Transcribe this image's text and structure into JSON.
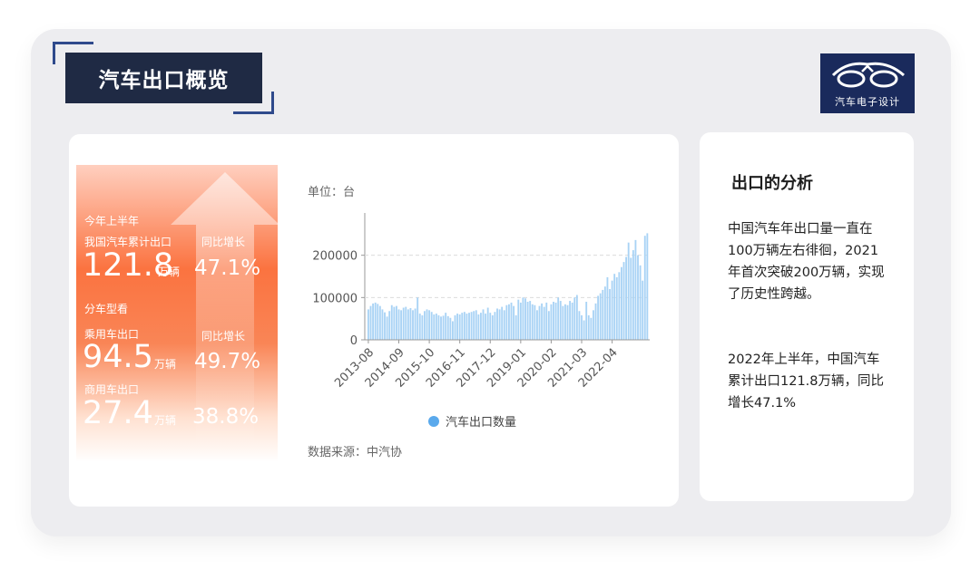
{
  "header": {
    "title": "汽车出口概览",
    "logo_text": "汽车电子设计"
  },
  "summary": {
    "period_label": "今年上半年",
    "total_label": "我国汽车累计出口",
    "total_value": "121.8",
    "total_unit": "万辆",
    "total_growth_label": "同比增长",
    "total_growth": "47.1%",
    "by_type_label": "分车型看",
    "passenger_label": "乘用车出口",
    "passenger_value": "94.5",
    "passenger_unit": "万辆",
    "passenger_growth_label": "同比增长",
    "passenger_growth": "49.7%",
    "commercial_label": "商用车出口",
    "commercial_value": "27.4",
    "commercial_unit": "万辆",
    "commercial_growth": "38.8%"
  },
  "chart_meta": {
    "unit": "单位：台",
    "source": "数据来源：中汽协"
  },
  "chart_data": {
    "type": "bar",
    "ylim": [
      0,
      300000
    ],
    "yticks": [
      0,
      100000,
      200000
    ],
    "ytick_labels": [
      "0",
      "100000",
      "200000"
    ],
    "xtick_labels": [
      "2013-08",
      "2014-09",
      "2015-10",
      "2016-11",
      "2017-12",
      "2019-01",
      "2020-02",
      "2021-03",
      "2022-04"
    ],
    "xtick_index": [
      0,
      13,
      26,
      39,
      52,
      65,
      78,
      91,
      104
    ],
    "grid": "horizontal-dashed",
    "legend": "bottom",
    "series": [
      {
        "name": "汽车出口数量",
        "color": "#a9d3f5"
      }
    ],
    "values": [
      72000,
      80000,
      86000,
      88000,
      85000,
      80000,
      72000,
      65000,
      55000,
      68000,
      82000,
      78000,
      80000,
      72000,
      70000,
      76000,
      78000,
      72000,
      75000,
      70000,
      74000,
      100000,
      62000,
      58000,
      68000,
      72000,
      70000,
      66000,
      60000,
      62000,
      58000,
      55000,
      57000,
      64000,
      56000,
      52000,
      44000,
      58000,
      62000,
      60000,
      64000,
      66000,
      62000,
      64000,
      66000,
      68000,
      70000,
      60000,
      64000,
      72000,
      62000,
      76000,
      64000,
      58000,
      66000,
      74000,
      72000,
      78000,
      70000,
      82000,
      84000,
      88000,
      80000,
      58000,
      95000,
      88000,
      100000,
      98000,
      90000,
      92000,
      84000,
      82000,
      70000,
      80000,
      86000,
      78000,
      88000,
      68000,
      84000,
      90000,
      88000,
      100000,
      92000,
      80000,
      84000,
      82000,
      92000,
      88000,
      100000,
      106000,
      68000,
      58000,
      46000,
      90000,
      58000,
      52000,
      70000,
      86000,
      104000,
      110000,
      118000,
      126000,
      148000,
      120000,
      140000,
      156000,
      148000,
      160000,
      172000,
      184000,
      196000,
      230000,
      194000,
      212000,
      236000,
      200000,
      176000,
      140000,
      246000,
      252000
    ]
  },
  "analysis": {
    "title": "出口的分析",
    "p1": "中国汽车年出口量一直在100万辆左右徘徊，2021年首次突破200万辆，实现了历史性跨越。",
    "p2": "2022年上半年，中国汽车累计出口121.8万辆，同比增长47.1%"
  }
}
